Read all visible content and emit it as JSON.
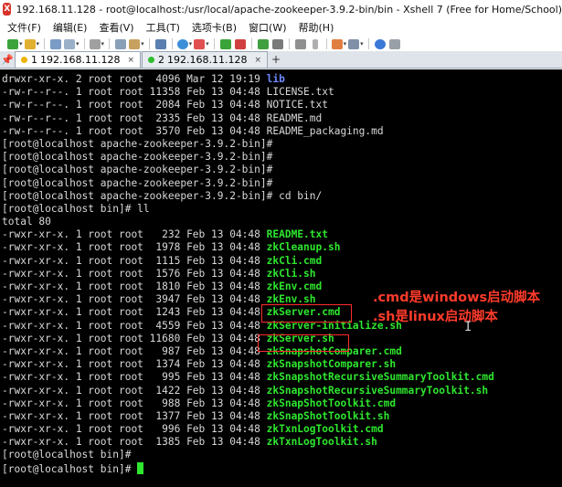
{
  "window": {
    "title": "192.168.11.128 - root@localhost:/usr/local/apache-zookeeper-3.9.2-bin/bin - Xshell 7 (Free for Home/School)",
    "app_icon": "xshell-logo-icon"
  },
  "menu": {
    "items": [
      "文件(F)",
      "编辑(E)",
      "查看(V)",
      "工具(T)",
      "选项卡(B)",
      "窗口(W)",
      "帮助(H)"
    ]
  },
  "tabs": {
    "pin_icon": "pin-icon",
    "items": [
      {
        "number": "1",
        "label": "192.168.11.128",
        "close": "×",
        "dot_color": "#f2b300",
        "active": true
      },
      {
        "number": "2",
        "label": "192.168.11.128",
        "close": "×",
        "dot_color": "#2dbd2d",
        "active": false
      }
    ],
    "add_label": "+"
  },
  "terminal": {
    "lines": [
      {
        "prefix": "drwxr-xr-x. 2 root root  4096 Mar 12 19:19 ",
        "name": "lib",
        "type": "dir"
      },
      {
        "prefix": "-rw-r--r--. 1 root root 11358 Feb 13 04:48 ",
        "name": "LICENSE.txt",
        "type": "plain"
      },
      {
        "prefix": "-rw-r--r--. 1 root root  2084 Feb 13 04:48 ",
        "name": "NOTICE.txt",
        "type": "plain"
      },
      {
        "prefix": "-rw-r--r--. 1 root root  2335 Feb 13 04:48 ",
        "name": "README.md",
        "type": "plain"
      },
      {
        "prefix": "-rw-r--r--. 1 root root  3570 Feb 13 04:48 ",
        "name": "README_packaging.md",
        "type": "plain"
      },
      {
        "prefix": "[root@localhost apache-zookeeper-3.9.2-bin]#",
        "name": "",
        "type": "plain"
      },
      {
        "prefix": "[root@localhost apache-zookeeper-3.9.2-bin]#",
        "name": "",
        "type": "plain"
      },
      {
        "prefix": "[root@localhost apache-zookeeper-3.9.2-bin]#",
        "name": "",
        "type": "plain"
      },
      {
        "prefix": "[root@localhost apache-zookeeper-3.9.2-bin]#",
        "name": "",
        "type": "plain"
      },
      {
        "prefix": "[root@localhost apache-zookeeper-3.9.2-bin]# cd bin/",
        "name": "",
        "type": "plain"
      },
      {
        "prefix": "[root@localhost bin]# ll",
        "name": "",
        "type": "plain"
      },
      {
        "prefix": "total 80",
        "name": "",
        "type": "plain"
      },
      {
        "prefix": "-rwxr-xr-x. 1 root root   232 Feb 13 04:48 ",
        "name": "README.txt",
        "type": "exec"
      },
      {
        "prefix": "-rwxr-xr-x. 1 root root  1978 Feb 13 04:48 ",
        "name": "zkCleanup.sh",
        "type": "exec"
      },
      {
        "prefix": "-rwxr-xr-x. 1 root root  1115 Feb 13 04:48 ",
        "name": "zkCli.cmd",
        "type": "exec"
      },
      {
        "prefix": "-rwxr-xr-x. 1 root root  1576 Feb 13 04:48 ",
        "name": "zkCli.sh",
        "type": "exec"
      },
      {
        "prefix": "-rwxr-xr-x. 1 root root  1810 Feb 13 04:48 ",
        "name": "zkEnv.cmd",
        "type": "exec"
      },
      {
        "prefix": "-rwxr-xr-x. 1 root root  3947 Feb 13 04:48 ",
        "name": "zkEnv.sh",
        "type": "exec"
      },
      {
        "prefix": "-rwxr-xr-x. 1 root root  1243 Feb 13 04:48 ",
        "name": "zkServer.cmd",
        "type": "exec"
      },
      {
        "prefix": "-rwxr-xr-x. 1 root root  4559 Feb 13 04:48 ",
        "name": "zkServer-initialize.sh",
        "type": "exec"
      },
      {
        "prefix": "-rwxr-xr-x. 1 root root 11680 Feb 13 04:48 ",
        "name": "zkServer.sh",
        "type": "exec"
      },
      {
        "prefix": "-rwxr-xr-x. 1 root root   987 Feb 13 04:48 ",
        "name": "zkSnapshotComparer.cmd",
        "type": "exec"
      },
      {
        "prefix": "-rwxr-xr-x. 1 root root  1374 Feb 13 04:48 ",
        "name": "zkSnapshotComparer.sh",
        "type": "exec"
      },
      {
        "prefix": "-rwxr-xr-x. 1 root root   995 Feb 13 04:48 ",
        "name": "zkSnapshotRecursiveSummaryToolkit.cmd",
        "type": "exec"
      },
      {
        "prefix": "-rwxr-xr-x. 1 root root  1422 Feb 13 04:48 ",
        "name": "zkSnapshotRecursiveSummaryToolkit.sh",
        "type": "exec"
      },
      {
        "prefix": "-rwxr-xr-x. 1 root root   988 Feb 13 04:48 ",
        "name": "zkSnapShotToolkit.cmd",
        "type": "exec"
      },
      {
        "prefix": "-rwxr-xr-x. 1 root root  1377 Feb 13 04:48 ",
        "name": "zkSnapShotToolkit.sh",
        "type": "exec"
      },
      {
        "prefix": "-rwxr-xr-x. 1 root root   996 Feb 13 04:48 ",
        "name": "zkTxnLogToolkit.cmd",
        "type": "exec"
      },
      {
        "prefix": "-rwxr-xr-x. 1 root root  1385 Feb 13 04:48 ",
        "name": "zkTxnLogToolkit.sh",
        "type": "exec"
      },
      {
        "prefix": "[root@localhost bin]#",
        "name": "",
        "type": "plain"
      },
      {
        "prefix": "[root@localhost bin]# ",
        "name": "",
        "type": "plain",
        "cursor": true
      }
    ],
    "colors": {
      "background": "#000000",
      "text": "#d9d9d9",
      "directory": "#6f89ff",
      "executable": "#2ee62e",
      "cursor": "#2ee62e"
    }
  },
  "annotations": {
    "cmd_note": ".cmd是windows启动脚本",
    "sh_note": ".sh是linux启动脚本",
    "color": "#ff3b2b"
  }
}
